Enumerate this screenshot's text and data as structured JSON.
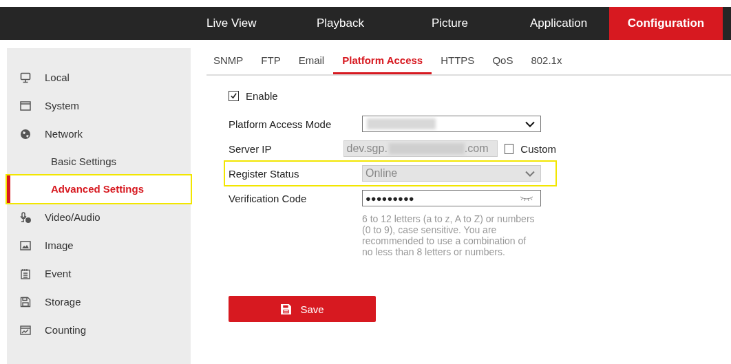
{
  "top_nav": [
    {
      "label": "Live View",
      "selected": false
    },
    {
      "label": "Playback",
      "selected": false
    },
    {
      "label": "Picture",
      "selected": false
    },
    {
      "label": "Application",
      "selected": false
    },
    {
      "label": "Configuration",
      "selected": true
    }
  ],
  "sidebar": {
    "items": [
      {
        "label": "Local",
        "selected": false,
        "highlighted": false
      },
      {
        "label": "System",
        "selected": false,
        "highlighted": false
      },
      {
        "label": "Network",
        "selected": false,
        "highlighted": false,
        "children": [
          {
            "label": "Basic Settings",
            "selected": false,
            "highlighted": false
          },
          {
            "label": "Advanced Settings",
            "selected": true,
            "highlighted": true
          }
        ]
      },
      {
        "label": "Video/Audio",
        "selected": false,
        "highlighted": false
      },
      {
        "label": "Image",
        "selected": false,
        "highlighted": false
      },
      {
        "label": "Event",
        "selected": false,
        "highlighted": false
      },
      {
        "label": "Storage",
        "selected": false,
        "highlighted": false
      },
      {
        "label": "Counting",
        "selected": false,
        "highlighted": false
      }
    ]
  },
  "tabs": [
    {
      "label": "SNMP",
      "selected": false
    },
    {
      "label": "FTP",
      "selected": false
    },
    {
      "label": "Email",
      "selected": false
    },
    {
      "label": "Platform Access",
      "selected": true
    },
    {
      "label": "HTTPS",
      "selected": false
    },
    {
      "label": "QoS",
      "selected": false
    },
    {
      "label": "802.1x",
      "selected": false
    }
  ],
  "enable": {
    "label": "Enable",
    "checked": true
  },
  "fields": [
    {
      "kind": "select",
      "label": "Platform Access Mode",
      "redacted": true,
      "disabled": false,
      "highlighted": false
    },
    {
      "kind": "text",
      "label": "Server IP",
      "value_prefix": "dev.sgp.",
      "value_suffix": ".com",
      "redacted": true,
      "disabled": true,
      "highlighted": false,
      "option": {
        "label": "Custom",
        "checked": false
      }
    },
    {
      "kind": "select",
      "label": "Register Status",
      "value": "Online",
      "disabled": true,
      "highlighted": true
    },
    {
      "kind": "password",
      "label": "Verification Code",
      "value": "●●●●●●●●●",
      "disabled": false,
      "highlighted": false,
      "hint": "6 to 12 letters (a to z, A to Z) or numbers (0 to 9), case sensitive. You are recommended to use a combination of no less than 8 letters or numbers."
    }
  ],
  "save_button": {
    "label": "Save"
  }
}
